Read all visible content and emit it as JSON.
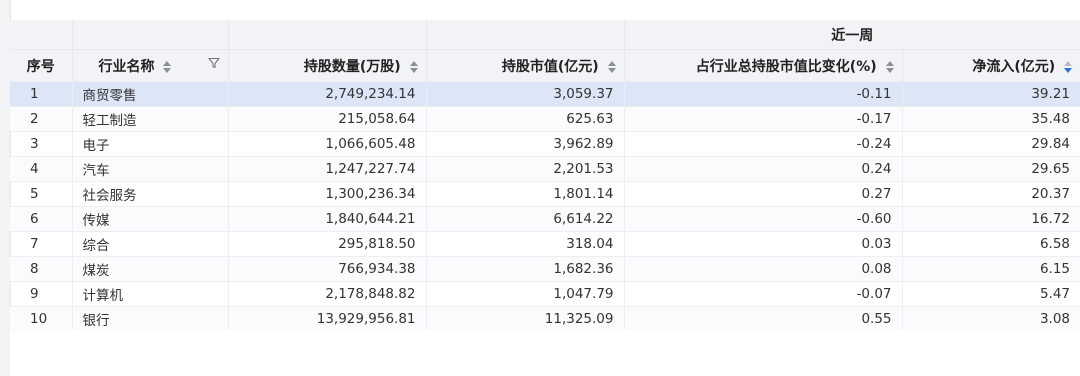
{
  "header": {
    "group_label": "近一周",
    "columns": [
      {
        "label": "序号"
      },
      {
        "label": "行业名称"
      },
      {
        "label": "持股数量(万股)"
      },
      {
        "label": "持股市值(亿元)"
      },
      {
        "label": "占行业总持股市值比变化(%)"
      },
      {
        "label": "净流入(亿元)"
      }
    ]
  },
  "sort_icons": {
    "default": "sort-both-icon",
    "active": "sort-desc-icon",
    "filter": "filter-icon"
  },
  "colors": {
    "selected_row": "#dde6f7",
    "header_bg": "#f2f3f6",
    "sort_active": "#2a6fdb"
  },
  "rows": [
    {
      "idx": "1",
      "name": "商贸零售",
      "shares": "2,749,234.14",
      "value": "3,059.37",
      "change": "-0.11",
      "inflow": "39.21"
    },
    {
      "idx": "2",
      "name": "轻工制造",
      "shares": "215,058.64",
      "value": "625.63",
      "change": "-0.17",
      "inflow": "35.48"
    },
    {
      "idx": "3",
      "name": "电子",
      "shares": "1,066,605.48",
      "value": "3,962.89",
      "change": "-0.24",
      "inflow": "29.84"
    },
    {
      "idx": "4",
      "name": "汽车",
      "shares": "1,247,227.74",
      "value": "2,201.53",
      "change": "0.24",
      "inflow": "29.65"
    },
    {
      "idx": "5",
      "name": "社会服务",
      "shares": "1,300,236.34",
      "value": "1,801.14",
      "change": "0.27",
      "inflow": "20.37"
    },
    {
      "idx": "6",
      "name": "传媒",
      "shares": "1,840,644.21",
      "value": "6,614.22",
      "change": "-0.60",
      "inflow": "16.72"
    },
    {
      "idx": "7",
      "name": "综合",
      "shares": "295,818.50",
      "value": "318.04",
      "change": "0.03",
      "inflow": "6.58"
    },
    {
      "idx": "8",
      "name": "煤炭",
      "shares": "766,934.38",
      "value": "1,682.36",
      "change": "0.08",
      "inflow": "6.15"
    },
    {
      "idx": "9",
      "name": "计算机",
      "shares": "2,178,848.82",
      "value": "1,047.79",
      "change": "-0.07",
      "inflow": "5.47"
    },
    {
      "idx": "10",
      "name": "银行",
      "shares": "13,929,956.81",
      "value": "11,325.09",
      "change": "0.55",
      "inflow": "3.08"
    }
  ]
}
